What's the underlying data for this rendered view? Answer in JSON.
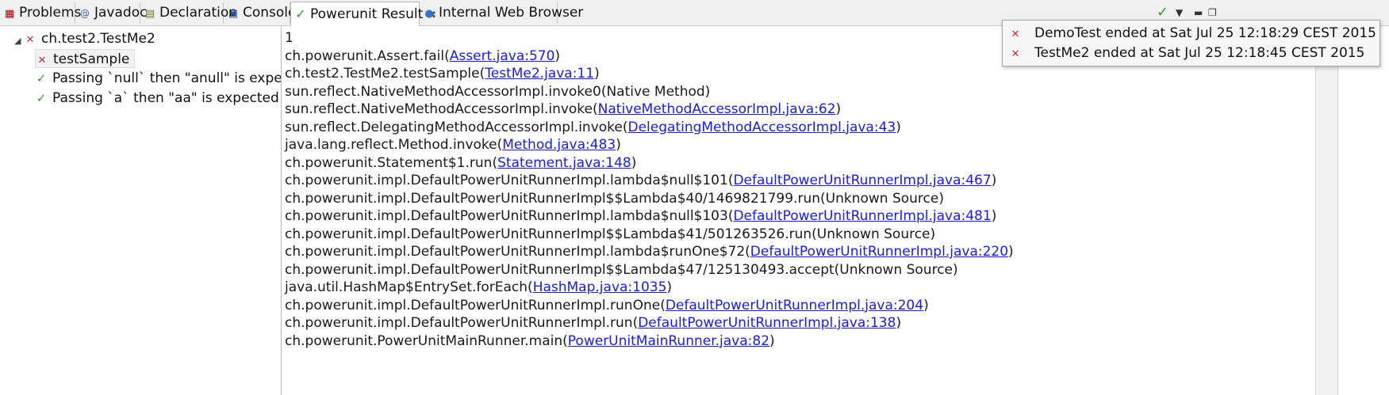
{
  "tabs": [
    {
      "label": "Problems",
      "icon": "problems-icon"
    },
    {
      "label": "Javadoc",
      "icon": "javadoc-icon"
    },
    {
      "label": "Declaration",
      "icon": "declaration-icon"
    },
    {
      "label": "Console",
      "icon": "console-icon"
    },
    {
      "label": "Powerunit Result",
      "icon": "powerunit-result-icon",
      "active": true
    },
    {
      "label": "Internal Web Browser",
      "icon": "web-browser-icon"
    }
  ],
  "toolbar": {
    "status_icon": "check-icon",
    "menu_icon": "view-menu-icon",
    "minimize_icon": "minimize-icon",
    "maximize_icon": "maximize-icon"
  },
  "tree": {
    "root": {
      "label": "ch.test2.TestMe2",
      "status": "failed"
    },
    "children": [
      {
        "label": "testSample",
        "status": "failed",
        "selected": true
      },
      {
        "label": "Passing `null` then \"anull\" is expected",
        "status": "passed"
      },
      {
        "label": "Passing `a` then \"aa\" is expected",
        "status": "passed"
      }
    ]
  },
  "trace": {
    "lines": [
      {
        "prefix": "1",
        "link": "",
        "suffix": ""
      },
      {
        "prefix": "ch.powerunit.Assert.fail(",
        "link": "Assert.java:570",
        "suffix": ")"
      },
      {
        "prefix": "ch.test2.TestMe2.testSample(",
        "link": "TestMe2.java:11",
        "suffix": ")"
      },
      {
        "prefix": "sun.reflect.NativeMethodAccessorImpl.invoke0(Native Method)",
        "link": "",
        "suffix": ""
      },
      {
        "prefix": "sun.reflect.NativeMethodAccessorImpl.invoke(",
        "link": "NativeMethodAccessorImpl.java:62",
        "suffix": ")"
      },
      {
        "prefix": "sun.reflect.DelegatingMethodAccessorImpl.invoke(",
        "link": "DelegatingMethodAccessorImpl.java:43",
        "suffix": ")"
      },
      {
        "prefix": "java.lang.reflect.Method.invoke(",
        "link": "Method.java:483",
        "suffix": ")"
      },
      {
        "prefix": "ch.powerunit.Statement$1.run(",
        "link": "Statement.java:148",
        "suffix": ")"
      },
      {
        "prefix": "ch.powerunit.impl.DefaultPowerUnitRunnerImpl.lambda$null$101(",
        "link": "DefaultPowerUnitRunnerImpl.java:467",
        "suffix": ")"
      },
      {
        "prefix": "ch.powerunit.impl.DefaultPowerUnitRunnerImpl$$Lambda$40/1469821799.run(Unknown Source)",
        "link": "",
        "suffix": ""
      },
      {
        "prefix": "ch.powerunit.impl.DefaultPowerUnitRunnerImpl.lambda$null$103(",
        "link": "DefaultPowerUnitRunnerImpl.java:481",
        "suffix": ")"
      },
      {
        "prefix": "ch.powerunit.impl.DefaultPowerUnitRunnerImpl$$Lambda$41/501263526.run(Unknown Source)",
        "link": "",
        "suffix": ""
      },
      {
        "prefix": "ch.powerunit.impl.DefaultPowerUnitRunnerImpl.lambda$runOne$72(",
        "link": "DefaultPowerUnitRunnerImpl.java:220",
        "suffix": ")"
      },
      {
        "prefix": "ch.powerunit.impl.DefaultPowerUnitRunnerImpl$$Lambda$47/125130493.accept(Unknown Source)",
        "link": "",
        "suffix": ""
      },
      {
        "prefix": "java.util.HashMap$EntrySet.forEach(",
        "link": "HashMap.java:1035",
        "suffix": ")"
      },
      {
        "prefix": "ch.powerunit.impl.DefaultPowerUnitRunnerImpl.runOne(",
        "link": "DefaultPowerUnitRunnerImpl.java:204",
        "suffix": ")"
      },
      {
        "prefix": "ch.powerunit.impl.DefaultPowerUnitRunnerImpl.run(",
        "link": "DefaultPowerUnitRunnerImpl.java:138",
        "suffix": ")"
      },
      {
        "prefix": "ch.powerunit.PowerUnitMainRunner.main(",
        "link": "PowerUnitMainRunner.java:82",
        "suffix": ")"
      }
    ]
  },
  "notifications": [
    {
      "text": "DemoTest ended at Sat Jul 25 12:18:29 CEST 2015",
      "status": "failed"
    },
    {
      "text": "TestMe2 ended at Sat Jul 25 12:18:45 CEST 2015",
      "status": "failed"
    }
  ],
  "colors": {
    "link": "#1a1fd6",
    "fail": "#cc3333",
    "pass": "#3b9a3b"
  }
}
